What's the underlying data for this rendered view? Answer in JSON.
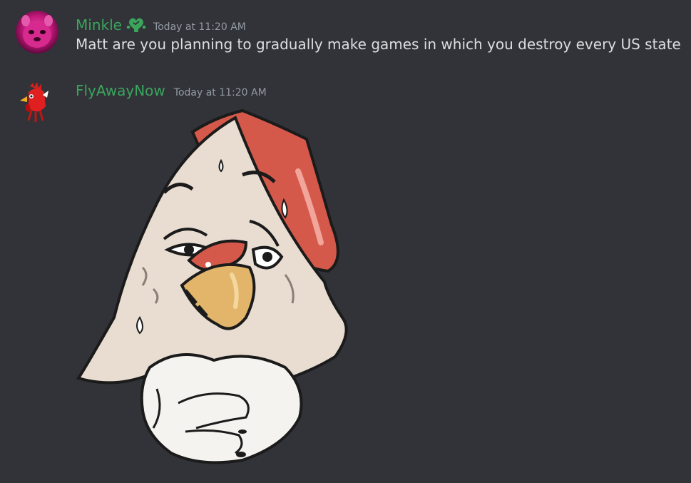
{
  "messages": [
    {
      "username": "Minkle",
      "username_color": "#3ba55c",
      "badge_icon": "nitro-boost-heart-icon",
      "timestamp": "Today at 11:20 AM",
      "text": "Matt are you planning to gradually make games in which you destroy every US state"
    },
    {
      "username": "FlyAwayNow",
      "username_color": "#3ba55c",
      "timestamp": "Today at 11:20 AM",
      "attachment": "chicken-sticker-image"
    }
  ],
  "colors": {
    "background": "#313338",
    "text": "#dbdee1",
    "muted": "#949ba4",
    "accent": "#3ba55c"
  }
}
